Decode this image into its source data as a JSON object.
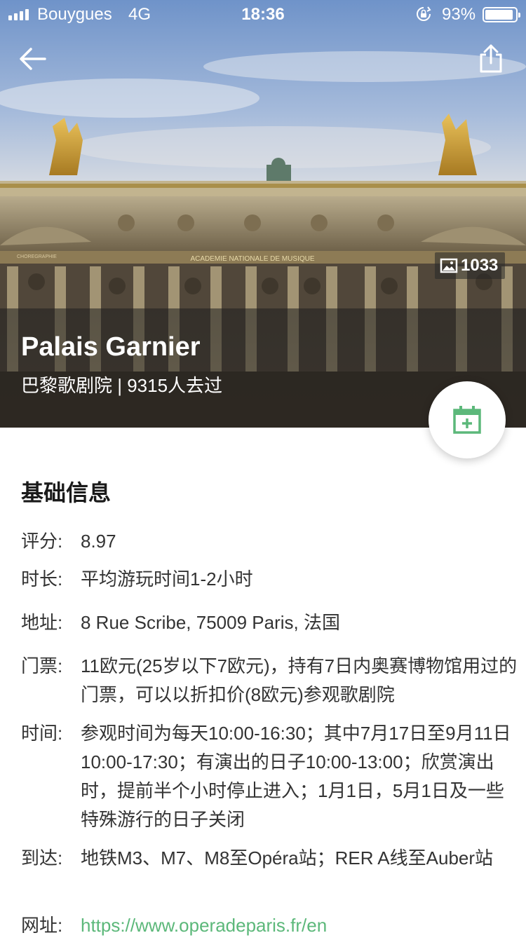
{
  "status_bar": {
    "carrier": "Bouygues",
    "network": "4G",
    "time": "18:36",
    "battery_percent": "93%",
    "battery_level": 0.93
  },
  "hero": {
    "photo_count": "1033",
    "title": "Palais Garnier",
    "subtitle": "巴黎歌剧院 | 9315人去过",
    "facade_inscription": "ACADEMIE NATIONALE DE MUSIQUE",
    "facade_sign": "CHOREGRAPHIE"
  },
  "icons": {
    "back": "back-arrow-icon",
    "share": "share-icon",
    "photos": "image-icon",
    "add_to_calendar": "calendar-add-icon"
  },
  "colors": {
    "accent_green": "#5cb87a",
    "text_primary": "#1a1a1a",
    "text_body": "#333333"
  },
  "info": {
    "section_title": "基础信息",
    "rows": [
      {
        "label": "评分:",
        "value": "8.97"
      },
      {
        "label": "时长:",
        "value": "平均游玩时间1-2小时"
      },
      {
        "label": "地址:",
        "value": "8 Rue Scribe, 75009 Paris, 法国"
      },
      {
        "label": "门票:",
        "value": "11欧元(25岁以下7欧元)，持有7日内奥赛博物馆用过的门票，可以以折扣价(8欧元)参观歌剧院"
      },
      {
        "label": "时间:",
        "value": "参观时间为每天10:00-16:30；其中7月17日至9月11日10:00-17:30；有演出的日子10:00-13:00；欣赏演出时，提前半个小时停止进入；1月1日，5月1日及一些特殊游行的日子关闭"
      },
      {
        "label": "到达:",
        "value": "地铁M3、M7、M8至Opéra站；RER A线至Auber站"
      },
      {
        "label": "网址:",
        "value": "https://www.operadeparis.fr/en"
      }
    ]
  }
}
